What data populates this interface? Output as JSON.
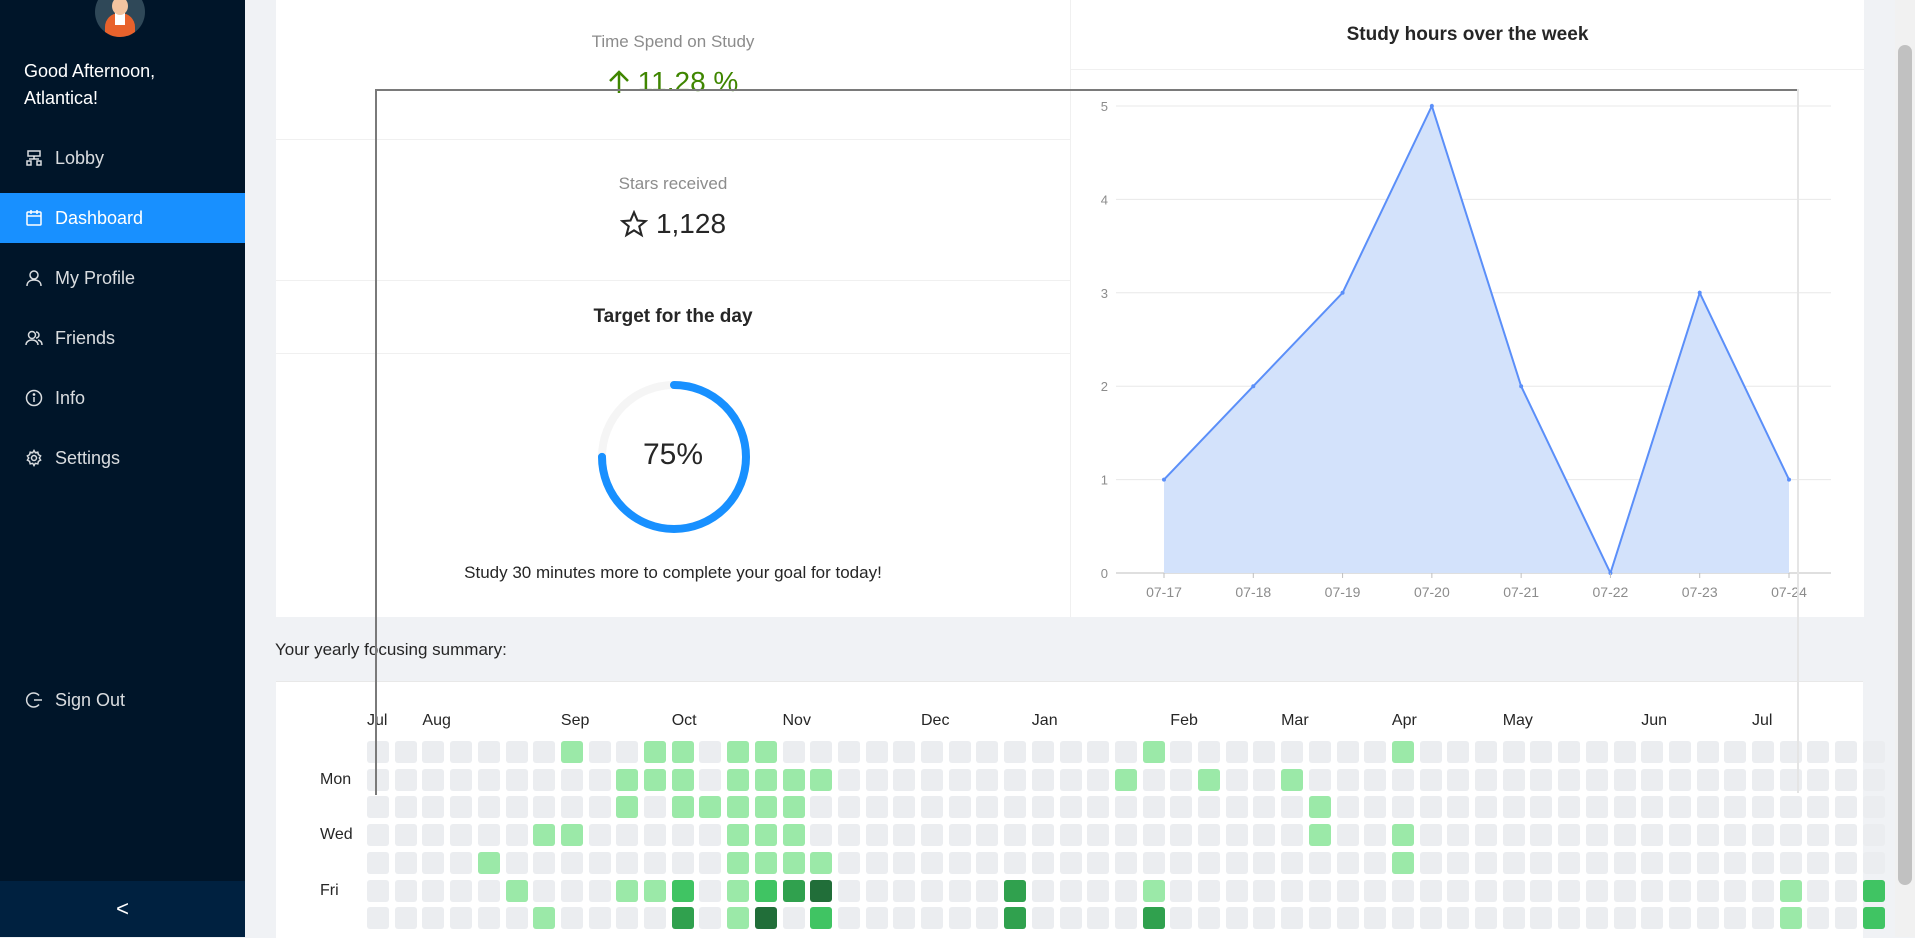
{
  "sidebar": {
    "greeting": "Good Afternoon, Atlantica!",
    "items": [
      {
        "label": "Lobby",
        "icon": "lobby-icon",
        "active": false
      },
      {
        "label": "Dashboard",
        "icon": "calendar-icon",
        "active": true
      },
      {
        "label": "My Profile",
        "icon": "user-icon",
        "active": false
      },
      {
        "label": "Friends",
        "icon": "friends-icon",
        "active": false
      },
      {
        "label": "Info",
        "icon": "info-icon",
        "active": false
      },
      {
        "label": "Settings",
        "icon": "gear-icon",
        "active": false
      }
    ],
    "signout": "Sign Out",
    "collapse_icon": "<"
  },
  "stats": {
    "time_label": "Time Spend on Study",
    "time_value": "11.28 %",
    "stars_label": "Stars received",
    "stars_value": "1,128"
  },
  "target": {
    "title": "Target for the day",
    "percent": 75,
    "percent_text": "75%",
    "message": "Study 30 minutes more to complete your goal for today!"
  },
  "chart_data": {
    "type": "area",
    "title": "Study hours over the week",
    "x": [
      "07-17",
      "07-18",
      "07-19",
      "07-20",
      "07-21",
      "07-22",
      "07-23",
      "07-24"
    ],
    "values": [
      1,
      2,
      3,
      5,
      2,
      0,
      3,
      1
    ],
    "yticks": [
      "0",
      "1",
      "2",
      "3",
      "4",
      "5"
    ],
    "ylim": [
      0,
      5
    ],
    "grid": true,
    "color": "#5b8ff9",
    "fill": "#d3e2fb"
  },
  "summary": {
    "label": "Your yearly focusing summary:",
    "months": [
      {
        "label": "Jul",
        "col": 0
      },
      {
        "label": "Aug",
        "col": 2
      },
      {
        "label": "Sep",
        "col": 7
      },
      {
        "label": "Oct",
        "col": 11
      },
      {
        "label": "Nov",
        "col": 15
      },
      {
        "label": "Dec",
        "col": 20
      },
      {
        "label": "Jan",
        "col": 24
      },
      {
        "label": "Feb",
        "col": 29
      },
      {
        "label": "Mar",
        "col": 33
      },
      {
        "label": "Apr",
        "col": 37
      },
      {
        "label": "May",
        "col": 41
      },
      {
        "label": "Jun",
        "col": 46
      },
      {
        "label": "Jul",
        "col": 50
      }
    ],
    "days": [
      {
        "label": "Mon",
        "row": 1
      },
      {
        "label": "Wed",
        "row": 3
      },
      {
        "label": "Fri",
        "row": 5
      }
    ],
    "levels": [
      "0000000100110110000000000000100000000100000000000000000",
      "0000000001110111100000000001001001000000000000000000000",
      "0000000001011111000000000000000000100000000000000000000",
      "0000001100000111000000000000000000100100000000000000000",
      "0000100000000111100000000000000000000100000000000000000",
      "0000010001120123400000030000100000000000000000000001002",
      "0000001000030140200000030000300000000000000000000001002"
    ],
    "colors": [
      "#ebedf0",
      "#9be9a8",
      "#40c463",
      "#30a14e",
      "#216e39"
    ]
  }
}
